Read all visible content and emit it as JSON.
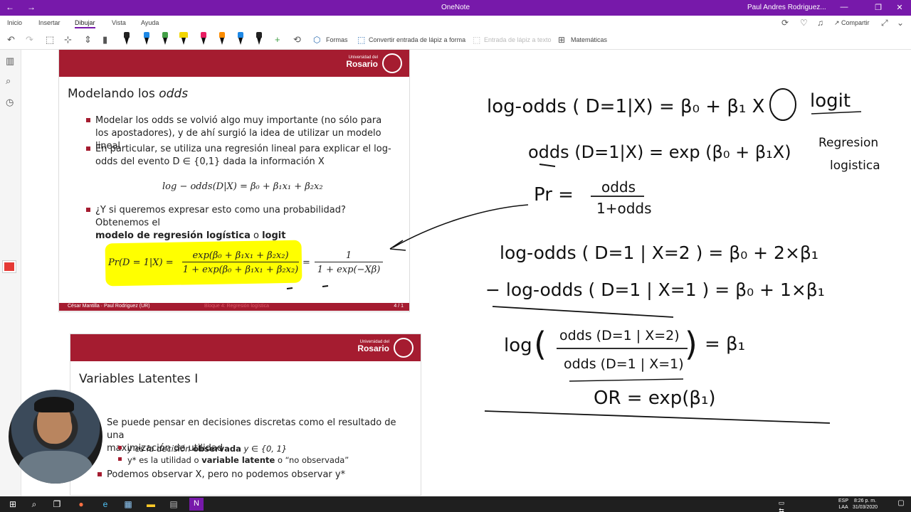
{
  "titlebar": {
    "app_title": "OneNote",
    "user": "Paul Andres Rodriguez..."
  },
  "ribbon": {
    "tabs": [
      "Inicio",
      "Insertar",
      "Dibujar",
      "Vista",
      "Ayuda"
    ],
    "active_tab": "Dibujar",
    "share_label": "Compartir"
  },
  "toolbar": {
    "shapes_label": "Formas",
    "convert_label": "Convertir entrada de lápiz a forma",
    "ink_to_text_label": "Entrada de lápiz a texto",
    "math_label": "Matemáticas",
    "pen_colors": [
      "#f2d600",
      "#222222",
      "#1e88e5",
      "#43a047",
      "#f2d600",
      "#e91e63",
      "#fb8c00",
      "#1e88e5",
      "#222222"
    ]
  },
  "slide1": {
    "brand_small": "Universidad del",
    "brand_big": "Rosario",
    "title_prefix": "Modelando los ",
    "title_italic": "odds",
    "bullet1": "Modelar los odds se volvió algo muy importante (no sólo para los apostadores), y de ahí surgió la idea de utilizar un modelo lineal",
    "bullet2": "En particular, se utiliza una regresión lineal para explicar el log-odds del evento D ∈ {0,1} dada la información X",
    "eq1": "log − odds(D|X) = β₀ + β₁x₁ + β₂x₂",
    "bullet3_a": "¿Y si queremos expresar esto como una probabilidad? Obtenemos el",
    "bullet3_b1": "modelo de regresión logística",
    "bullet3_o": " o ",
    "bullet3_b2": "logit",
    "eq2_lhs": "Pr(D = 1|X) =",
    "eq2_num": "exp(β₀ + β₁x₁ + β₂x₂)",
    "eq2_den": "1 + exp(β₀ + β₁x₁ + β₂x₂)",
    "eq2_eq": "=",
    "eq2_num2": "1",
    "eq2_den2": "1 + exp(−Xβ)",
    "footer_left": "César Mantilla · Paul Rodriguez  (UR)",
    "footer_mid": "Bloque 4: Regresión logística",
    "footer_right": "4 / 1"
  },
  "slide2": {
    "brand_small": "Universidad del",
    "brand_big": "Rosario",
    "title": "Variables Latentes I",
    "line1": "Se puede pensar en decisiones discretas como el resultado de una",
    "line2": "maximización de utilidad",
    "sub1_pre": "y es la decisión ",
    "sub1_bold": "observada",
    "sub1_post": " y ∈ {0, 1}",
    "sub2_pre": "y* es la utilidad o ",
    "sub2_bold": "variable latente",
    "sub2_post": " o “no observada”",
    "bullet": "Podemos observar X, pero no podemos observar y*"
  },
  "ink": {
    "line1": "log-odds ( D=1|X) = β₀ + β₁ X",
    "logit": "logit",
    "regresion": "Regresion",
    "logistica": "logistica",
    "line2": "odds (D=1|X) = exp (β₀ + β₁X)",
    "pr": "Pr =",
    "pr_num": "odds",
    "pr_den": "1+odds",
    "line3": "log-odds ( D=1 | X=2 ) = β₀ + 2×β₁",
    "line4": "− log-odds ( D=1 | X=1 ) = β₀ + 1×β₁",
    "log": "log",
    "frac_num": "odds (D=1 | X=2)",
    "frac_den": "odds (D=1 | X=1)",
    "eq_b1": "= β₁",
    "or": "OR = exp(β₁)"
  },
  "taskbar": {
    "lang1": "ESP",
    "lang2": "LAA",
    "time": "8:26 p. m.",
    "date": "31/03/2020"
  }
}
